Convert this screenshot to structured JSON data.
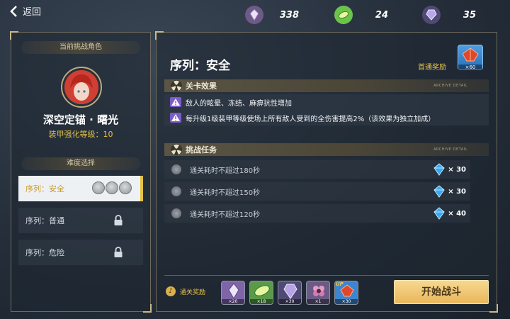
{
  "topbar": {
    "back_label": "返回",
    "resources": [
      {
        "icon": "purple-crystal-icon",
        "value": "338"
      },
      {
        "icon": "green-disc-icon",
        "value": "24"
      },
      {
        "icon": "purple-gem-icon",
        "value": "35"
      }
    ]
  },
  "left_panel": {
    "current_label": "当前挑战角色",
    "character_name": "深空定锚 · 曙光",
    "armor_level": "装甲强化等级：10",
    "difficulty_label": "难度选择",
    "difficulties": [
      {
        "label": "序列：安全",
        "state": "selected",
        "medals": 3
      },
      {
        "label": "序列：普通",
        "state": "locked"
      },
      {
        "label": "序列：危险",
        "state": "locked"
      }
    ]
  },
  "main": {
    "title": "序列：安全",
    "first_reward_label": "首通奖励",
    "first_reward_count": "×60",
    "effects_header": "关卡效果",
    "archive_detail": "ARCHIVE DETAIL",
    "effects": [
      "敌人的眩晕、冻结、麻痹抗性增加",
      "每升级1级装甲等级使场上所有敌人受到的全伤害提高2%（该效果为独立加成）"
    ],
    "tasks_header": "挑战任务",
    "tasks": [
      {
        "text": "通关耗时不超过180秒",
        "reward": "× 30"
      },
      {
        "text": "通关耗时不超过150秒",
        "reward": "× 30"
      },
      {
        "text": "通关耗时不超过120秒",
        "reward": "× 40"
      }
    ],
    "clear_reward_label": "通关奖励",
    "clear_rewards": [
      {
        "icon": "purple-crystal-icon",
        "count": "×20"
      },
      {
        "icon": "green-disc-icon",
        "count": "×18"
      },
      {
        "icon": "purple-gem-icon",
        "count": "×30"
      },
      {
        "icon": "pink-flower-icon",
        "count": "×1"
      },
      {
        "icon": "red-crystal-up-icon",
        "count": "×30",
        "badge": "UP"
      }
    ],
    "start_button": "开始战斗"
  },
  "colors": {
    "accent_gold": "#e2c04a",
    "button": "#f2cf82"
  }
}
